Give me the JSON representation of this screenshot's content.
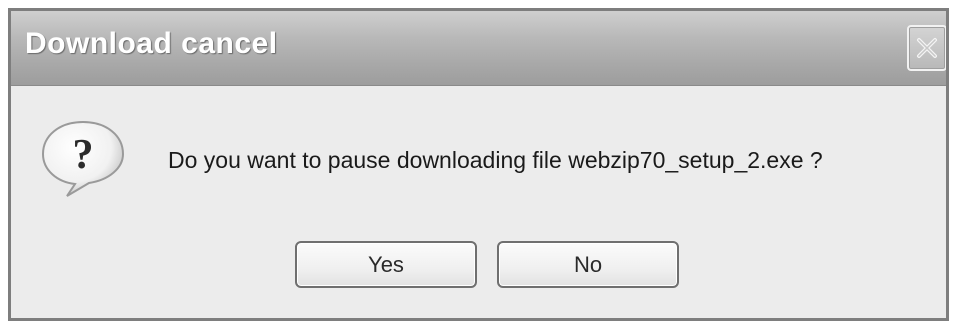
{
  "dialog": {
    "title": "Download cancel",
    "message": "Do you want to pause downloading file webzip70_setup_2.exe ?",
    "icon": "question-icon",
    "buttons": {
      "yes_label": "Yes",
      "no_label": "No"
    },
    "close_icon": "close-icon"
  }
}
